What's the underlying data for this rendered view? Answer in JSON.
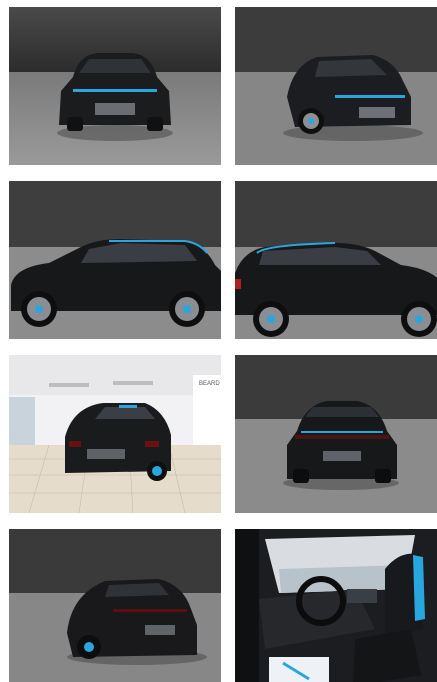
{
  "gallery": {
    "photos": [
      {
        "view": "front"
      },
      {
        "view": "front-three-quarter-right"
      },
      {
        "view": "side-left"
      },
      {
        "view": "side-right"
      },
      {
        "view": "rear-three-quarter-showroom"
      },
      {
        "view": "rear"
      },
      {
        "view": "rear-three-quarter-left"
      },
      {
        "view": "interior-driver-seat"
      }
    ],
    "showroom_sign": "BEARD",
    "colors": {
      "car_body": "#1a1b1d",
      "accent_blue": "#2aa6df",
      "backdrop_wall": "#3a3a3a",
      "backdrop_floor": "#8a8a8a"
    }
  }
}
